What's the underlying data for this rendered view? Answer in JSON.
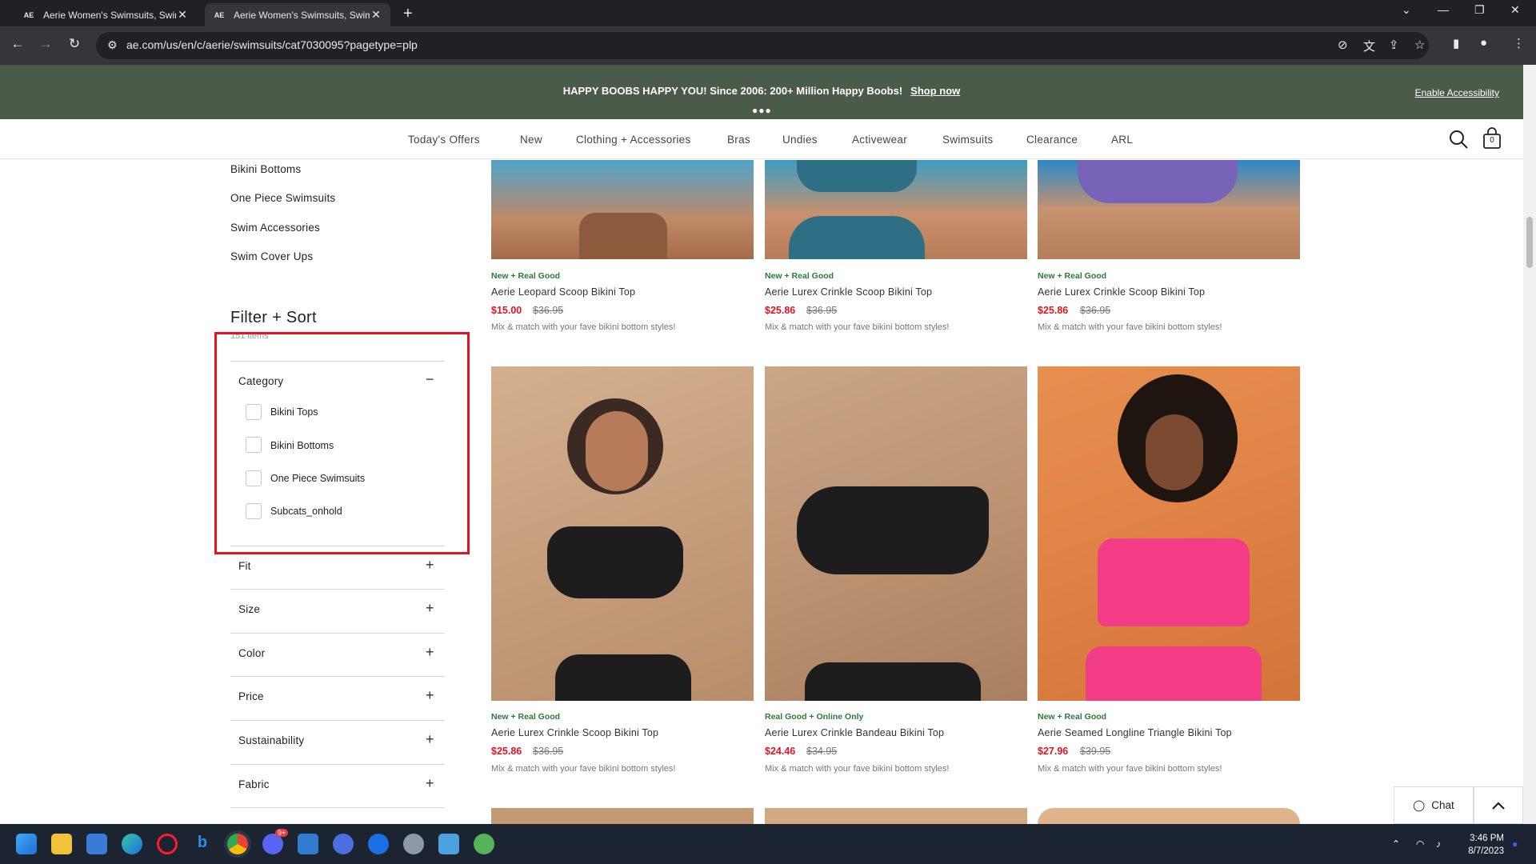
{
  "browser": {
    "tabs": [
      {
        "favicon": "AE",
        "title": "Aerie Women's Swimsuits, Swim"
      },
      {
        "favicon": "AE",
        "title": "Aerie Women's Swimsuits, Swim"
      }
    ],
    "url": "ae.com/us/en/c/aerie/swimsuits/cat7030095?pagetype=plp"
  },
  "promo": {
    "message": "HAPPY BOOBS HAPPY YOU! Since 2006: 200+ Million Happy Boobs!",
    "link": "Shop now",
    "accessibility": "Enable Accessibility"
  },
  "nav": {
    "items": [
      "Today's Offers",
      "New",
      "Clothing + Accessories",
      "Bras",
      "Undies",
      "Activewear",
      "Swimsuits",
      "Clearance",
      "ARL"
    ],
    "bag_count": "0"
  },
  "sidebar": {
    "links": [
      "Bikini Bottoms",
      "One Piece Swimsuits",
      "Swim Accessories",
      "Swim Cover Ups"
    ],
    "filter_title": "Filter + Sort",
    "items_count": "151 items",
    "category": {
      "label": "Category",
      "options": [
        "Bikini Tops",
        "Bikini Bottoms",
        "One Piece Swimsuits",
        "Subcats_onhold"
      ]
    },
    "filters": [
      "Fit",
      "Size",
      "Color",
      "Price",
      "Sustainability",
      "Fabric"
    ]
  },
  "products": [
    {
      "badge": "New + Real Good",
      "name": "Aerie Leopard Scoop Bikini Top",
      "price": "$15.00",
      "old_price": "$36.95",
      "desc": "Mix & match with your fave bikini bottom styles!"
    },
    {
      "badge": "New + Real Good",
      "name": "Aerie Lurex Crinkle Scoop Bikini Top",
      "price": "$25.86",
      "old_price": "$36.95",
      "desc": "Mix & match with your fave bikini bottom styles!"
    },
    {
      "badge": "New + Real Good",
      "name": "Aerie Lurex Crinkle Scoop Bikini Top",
      "price": "$25.86",
      "old_price": "$36.95",
      "desc": "Mix & match with your fave bikini bottom styles!"
    },
    {
      "badge": "New + Real Good",
      "name": "Aerie Lurex Crinkle Scoop Bikini Top",
      "price": "$25.86",
      "old_price": "$36.95",
      "desc": "Mix & match with your fave bikini bottom styles!"
    },
    {
      "badge": "Real Good + Online Only",
      "name": "Aerie Lurex Crinkle Bandeau Bikini Top",
      "price": "$24.46",
      "old_price": "$34.95",
      "desc": "Mix & match with your fave bikini bottom styles!"
    },
    {
      "badge": "New + Real Good",
      "name": "Aerie Seamed Longline Triangle Bikini Top",
      "price": "$27.96",
      "old_price": "$39.95",
      "desc": "Mix & match with your fave bikini bottom styles!"
    }
  ],
  "chat": {
    "label": "Chat"
  },
  "taskbar": {
    "time": "3:46 PM",
    "date": "8/7/2023",
    "discord_badge": "9+"
  },
  "colors": {
    "promo_bg": "#4a5b4a",
    "price_red": "#e2141f",
    "badge_green": "#2c7a3a",
    "highlight_box": "#e2141f"
  }
}
